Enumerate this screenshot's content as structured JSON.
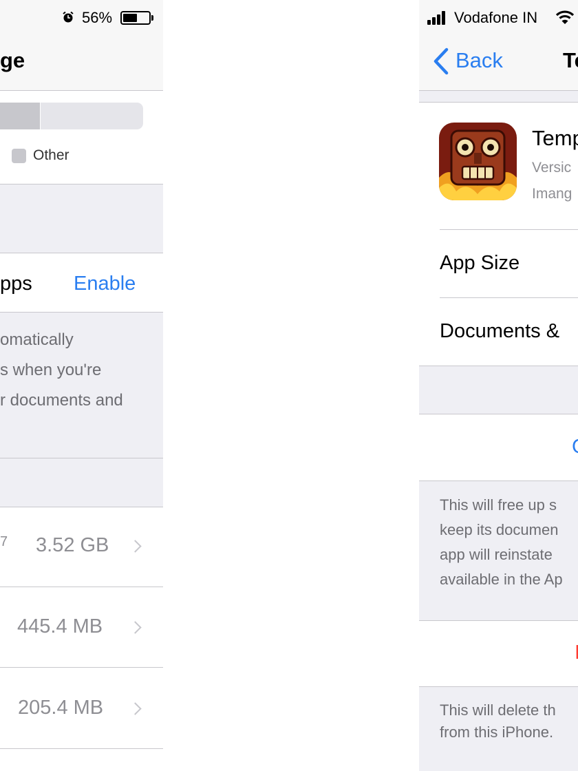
{
  "left_panel": {
    "status": {
      "battery_percent": "56%",
      "battery_level": 0.56,
      "icons": [
        "alarm-clock-icon",
        "battery-icon"
      ]
    },
    "nav_title": "ge",
    "legend": {
      "other_label": "Other"
    },
    "offload": {
      "title": "pps",
      "action": "Enable"
    },
    "description_lines": [
      "omatically",
      "s when you're",
      "r documents and"
    ],
    "apps": [
      {
        "sub": "7",
        "size": "3.52 GB"
      },
      {
        "sub": "",
        "size": "445.4 MB"
      },
      {
        "sub": "",
        "size": "205.4 MB"
      }
    ],
    "colors": {
      "accent": "#2a7ef0",
      "background": "#efeff4"
    }
  },
  "right_panel": {
    "status": {
      "carrier": "Vodafone IN",
      "icons": [
        "signal-bars-icon",
        "wifi-icon"
      ]
    },
    "nav": {
      "back_label": "Back",
      "title": "Te"
    },
    "app": {
      "name": "Temp",
      "version": "Versic",
      "developer": "Imang",
      "icon": "temple-idol-icon"
    },
    "rows": [
      {
        "label": "App Size"
      },
      {
        "label": "Documents &"
      }
    ],
    "offload_button": "C",
    "offload_description": [
      "This will free up s",
      "keep its documen",
      "app will reinstate",
      "available in the Ap"
    ],
    "delete_button": "I",
    "delete_description": [
      "This will delete th",
      "from this iPhone."
    ],
    "colors": {
      "accent": "#2a7ef0",
      "destructive": "#ff3b30",
      "background": "#efeff4"
    }
  }
}
